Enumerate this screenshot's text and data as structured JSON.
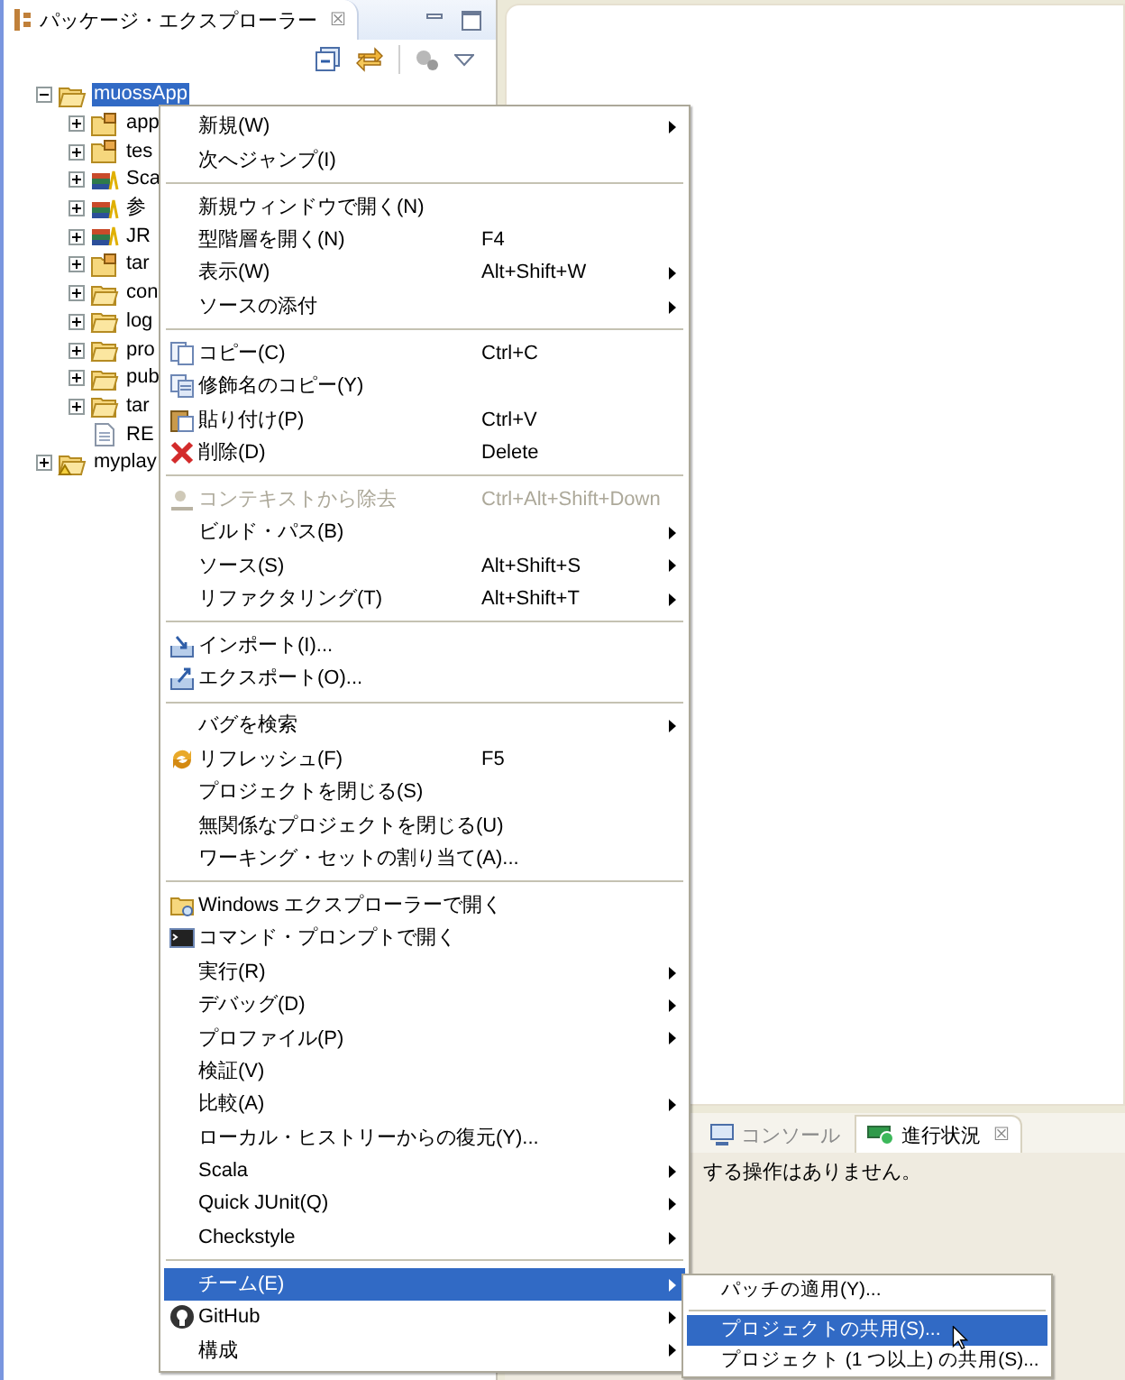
{
  "explorer": {
    "title": "パッケージ・エクスプローラー",
    "close": "☒",
    "tree": [
      {
        "label": "muossApp",
        "kind": "project",
        "selected": true,
        "expanded": true,
        "children": [
          {
            "label": "app",
            "kind": "package-folder",
            "selected": false,
            "expanded": false
          },
          {
            "label": "tes",
            "kind": "package-folder",
            "selected": false,
            "expanded": false
          },
          {
            "label": "Sca",
            "kind": "library",
            "selected": false,
            "expanded": false
          },
          {
            "label": "参",
            "kind": "library",
            "selected": false,
            "expanded": false
          },
          {
            "label": "JR",
            "kind": "library",
            "selected": false,
            "expanded": false
          },
          {
            "label": "tar",
            "kind": "package-folder",
            "selected": false,
            "expanded": false
          },
          {
            "label": "con",
            "kind": "folder",
            "selected": false,
            "expanded": false
          },
          {
            "label": "log",
            "kind": "folder",
            "selected": false,
            "expanded": false
          },
          {
            "label": "pro",
            "kind": "folder",
            "selected": false,
            "expanded": false
          },
          {
            "label": "pub",
            "kind": "folder",
            "selected": false,
            "expanded": false
          },
          {
            "label": "tar",
            "kind": "folder",
            "selected": false,
            "expanded": false
          },
          {
            "label": "RE",
            "kind": "file",
            "selected": false
          }
        ]
      },
      {
        "label": "myplay",
        "kind": "project-warning",
        "selected": false,
        "expanded": false
      }
    ]
  },
  "bottom_panel": {
    "tabs": [
      {
        "label": "コンソール",
        "selected": false
      },
      {
        "label": "進行状況",
        "selected": true
      }
    ],
    "close": "☒",
    "message": "する操作はありません。"
  },
  "context_menu": [
    {
      "kind": "plain",
      "label": "新規(W)",
      "submenu": true,
      "selected": false,
      "disabled": false
    },
    {
      "kind": "plain",
      "label": "次へジャンプ(I)",
      "selected": false,
      "disabled": false
    },
    {
      "kind": "separator"
    },
    {
      "kind": "plain",
      "label": "新規ウィンドウで開く(N)",
      "selected": false,
      "disabled": false
    },
    {
      "kind": "plain",
      "label": "型階層を開く(N)",
      "shortcut": "F4",
      "selected": false,
      "disabled": false
    },
    {
      "kind": "plain",
      "label": "表示(W)",
      "shortcut": "Alt+Shift+W",
      "submenu": true,
      "selected": false,
      "disabled": false
    },
    {
      "kind": "plain",
      "label": "ソースの添付",
      "submenu": true,
      "selected": false,
      "disabled": false
    },
    {
      "kind": "separator"
    },
    {
      "kind": "copy",
      "label": "コピー(C)",
      "shortcut": "Ctrl+C",
      "selected": false,
      "disabled": false
    },
    {
      "kind": "copy-name",
      "label": "修飾名のコピー(Y)",
      "selected": false,
      "disabled": false
    },
    {
      "kind": "paste",
      "label": "貼り付け(P)",
      "shortcut": "Ctrl+V",
      "selected": false,
      "disabled": false
    },
    {
      "kind": "delete",
      "label": "削除(D)",
      "shortcut": "Delete",
      "selected": false,
      "disabled": false
    },
    {
      "kind": "separator"
    },
    {
      "kind": "remove",
      "label": "コンテキストから除去",
      "shortcut": "Ctrl+Alt+Shift+Down",
      "selected": false,
      "disabled": true
    },
    {
      "kind": "plain",
      "label": "ビルド・パス(B)",
      "submenu": true,
      "selected": false,
      "disabled": false
    },
    {
      "kind": "plain",
      "label": "ソース(S)",
      "shortcut": "Alt+Shift+S",
      "submenu": true,
      "selected": false,
      "disabled": false
    },
    {
      "kind": "plain",
      "label": "リファクタリング(T)",
      "shortcut": "Alt+Shift+T",
      "submenu": true,
      "selected": false,
      "disabled": false
    },
    {
      "kind": "separator"
    },
    {
      "kind": "import",
      "label": "インポート(I)...",
      "selected": false,
      "disabled": false
    },
    {
      "kind": "export",
      "label": "エクスポート(O)...",
      "selected": false,
      "disabled": false
    },
    {
      "kind": "separator"
    },
    {
      "kind": "plain",
      "label": "バグを検索",
      "submenu": true,
      "selected": false,
      "disabled": false
    },
    {
      "kind": "refresh",
      "label": "リフレッシュ(F)",
      "shortcut": "F5",
      "selected": false,
      "disabled": false
    },
    {
      "kind": "plain",
      "label": "プロジェクトを閉じる(S)",
      "selected": false,
      "disabled": false
    },
    {
      "kind": "plain",
      "label": "無関係なプロジェクトを閉じる(U)",
      "selected": false,
      "disabled": false
    },
    {
      "kind": "plain",
      "label": "ワーキング・セットの割り当て(A)...",
      "selected": false,
      "disabled": false
    },
    {
      "kind": "separator"
    },
    {
      "kind": "explorer",
      "label": "Windows エクスプローラーで開く",
      "selected": false,
      "disabled": false
    },
    {
      "kind": "terminal",
      "label": "コマンド・プロンプトで開く",
      "selected": false,
      "disabled": false
    },
    {
      "kind": "plain",
      "label": "実行(R)",
      "submenu": true,
      "selected": false,
      "disabled": false
    },
    {
      "kind": "plain",
      "label": "デバッグ(D)",
      "submenu": true,
      "selected": false,
      "disabled": false
    },
    {
      "kind": "plain",
      "label": "プロファイル(P)",
      "submenu": true,
      "selected": false,
      "disabled": false
    },
    {
      "kind": "plain",
      "label": "検証(V)",
      "selected": false,
      "disabled": false
    },
    {
      "kind": "plain",
      "label": "比較(A)",
      "submenu": true,
      "selected": false,
      "disabled": false
    },
    {
      "kind": "plain",
      "label": "ローカル・ヒストリーからの復元(Y)...",
      "selected": false,
      "disabled": false
    },
    {
      "kind": "plain",
      "label": "Scala",
      "submenu": true,
      "selected": false,
      "disabled": false
    },
    {
      "kind": "plain",
      "label": "Quick JUnit(Q)",
      "submenu": true,
      "selected": false,
      "disabled": false
    },
    {
      "kind": "plain",
      "label": "Checkstyle",
      "submenu": true,
      "selected": false,
      "disabled": false
    },
    {
      "kind": "separator"
    },
    {
      "kind": "plain",
      "label": "チーム(E)",
      "submenu": true,
      "selected": true,
      "disabled": false
    },
    {
      "kind": "github",
      "label": "GitHub",
      "submenu": true,
      "selected": false,
      "disabled": false
    },
    {
      "kind": "plain",
      "label": "構成",
      "submenu": true,
      "selected": false,
      "disabled": false
    }
  ],
  "team_submenu": [
    {
      "kind": "plain",
      "label": "パッチの適用(Y)...",
      "selected": false,
      "disabled": false
    },
    {
      "kind": "separator"
    },
    {
      "kind": "plain",
      "label": "プロジェクトの共用(S)...",
      "selected": true,
      "disabled": false
    },
    {
      "kind": "plain",
      "label": "プロジェクト (1 つ以上) の共用(S)...",
      "selected": false,
      "disabled": false
    }
  ]
}
